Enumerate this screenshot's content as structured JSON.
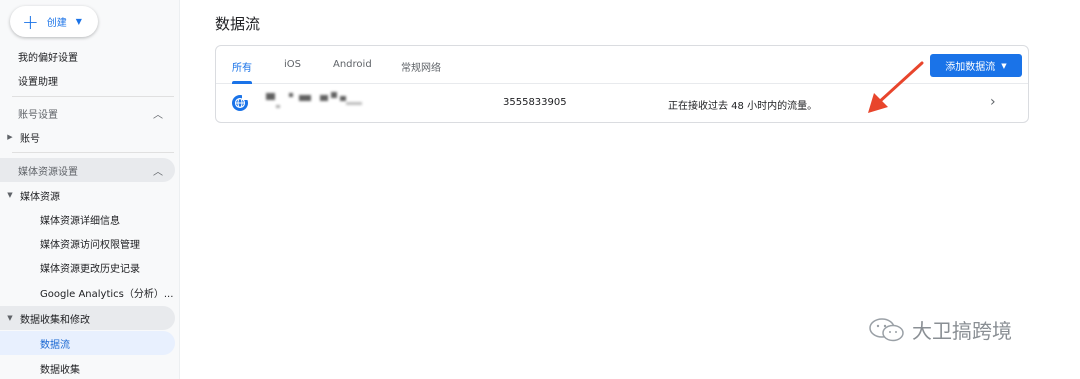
{
  "sidebar": {
    "create_label": "创建",
    "items": [
      {
        "label": "我的偏好设置"
      },
      {
        "label": "设置助理"
      },
      {
        "label": "账号设置"
      },
      {
        "label": "账号"
      },
      {
        "label": "媒体资源设置"
      },
      {
        "label": "媒体资源"
      },
      {
        "label": "媒体资源详细信息"
      },
      {
        "label": "媒体资源访问权限管理"
      },
      {
        "label": "媒体资源更改历史记录"
      },
      {
        "label": "Google Analytics（分析）..."
      },
      {
        "label": "数据收集和修改"
      },
      {
        "label": "数据流"
      },
      {
        "label": "数据收集"
      }
    ]
  },
  "main": {
    "title": "数据流",
    "tabs": [
      {
        "label": "所有"
      },
      {
        "label": "iOS"
      },
      {
        "label": "Android"
      },
      {
        "label": "常规网络"
      }
    ],
    "add_stream_label": "添加数据流",
    "stream": {
      "id": "3555833905",
      "status": "正在接收过去 48 小时内的流量。"
    }
  },
  "watermark": {
    "text": "大卫搞跨境"
  },
  "colors": {
    "accent": "#1a73e8",
    "annotation": "#e8452c"
  }
}
